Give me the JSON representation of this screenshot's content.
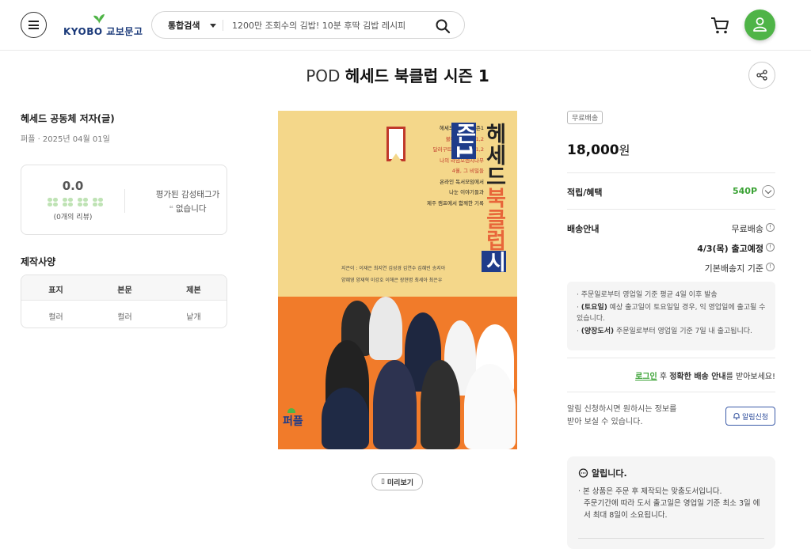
{
  "header": {
    "logo_text": "KYOBO 교보문고",
    "search_category": "통합검색",
    "search_placeholder": "1200만 조회수의 김밥! 10분 후딱 김밥 레시피"
  },
  "product": {
    "title_prefix": "POD",
    "title": "헤세드 북클럽 시즌 1",
    "author": "헤세드 공동체 저자(글)",
    "publisher_date": "퍼플 · 2025년 04월 01일"
  },
  "rating": {
    "score": "0.0",
    "reviews": "(0개의 리뷰)",
    "tag_line1": "평가된 감성태그가",
    "tag_line2": "없습니다"
  },
  "spec": {
    "title": "제작사양",
    "headers": [
      "표지",
      "본문",
      "제본"
    ],
    "values": [
      "컬러",
      "컬러",
      "낱개"
    ]
  },
  "cover": {
    "line1": "헤세드 북클럽 시즌1",
    "line2": "불편한 편의점1,2",
    "line3": "달러구트 꿈 백화점 1,2",
    "line4": "나의 라임오렌지나무",
    "line5": "4월, 그 비밀들",
    "line6": "온라인 독서모임에서",
    "line7": "나눈 이야기들과",
    "line8": "제주 캠프에서 함께한 기록",
    "v_part1": "헤세드",
    "v_part2": "북클럽",
    "v_part3": "시즌1",
    "authors1": "지은이 : 이재은 최지연 김성경 김연수 김혜빈 송지아",
    "authors2": "양혜영 양재혁 이강호 이해은 장현명 최세아 최은우",
    "publisher": "퍼플"
  },
  "preview_label": "미리보기",
  "purchase": {
    "badge": "무료배송",
    "price": "18,000",
    "currency": "원",
    "benefit_label": "적립/혜택",
    "points": "540P",
    "delivery_label": "배송안내",
    "delivery_type": "무료배송",
    "delivery_date": "4/3(목) 출고예정",
    "delivery_basis": "기본배송지 기준",
    "notice1": "· 주문일로부터 영업일 기준 평균 4일 이후 발송",
    "notice2_bold": "(토요일)",
    "notice2": " 예상 출고일이 토요일일 경우, 익 영업일에 출고될 수 있습니다.",
    "notice3_bold": "(양장도서)",
    "notice3": " 주문일로부터 영업일 기준 7일 내 출고됩니다.",
    "login_link": "로그인",
    "login_mid": " 후 ",
    "login_bold": "정확한 배송 안내",
    "login_end": "를 받아보세요!",
    "alert_text": "알림 신청하시면 원하시는 정보를 받아 보실 수 있습니다.",
    "alert_button": "알림신청"
  },
  "announce": {
    "heading": "알립니다.",
    "line1": "· 본 상품은 주문 후 제작되는 맞춤도서입니다.",
    "line2": "주문기간에 따라 도서 출고일은 영업일 기준 최소 3일 에서 최대 8일이 소요됩니다."
  },
  "colors": {
    "brand_green": "#4fb447",
    "points_green": "#3aa234",
    "cover_yellow": "#f4d78a",
    "cover_orange": "#f17b2a"
  }
}
